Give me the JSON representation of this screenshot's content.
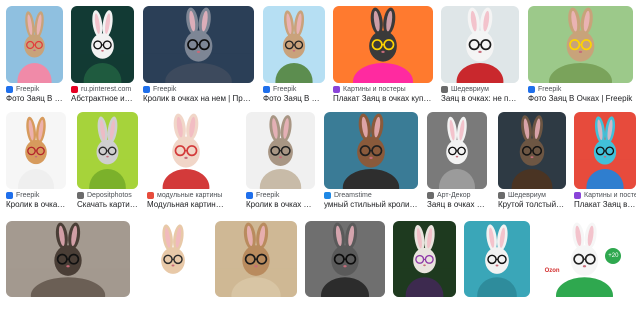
{
  "results": [
    {
      "source": "Freepik",
      "title": "Фото Заяц В Очка…",
      "favicon": "#1f6feb",
      "thumb_icon": "rabbit-pink-suit-image",
      "bg": "#8fc0e0",
      "fur": "#c8a37a",
      "glasses": "#e23b3b",
      "shirt": "#f08aa8"
    },
    {
      "source": "ru.pinterest.com",
      "title": "Абстрактное иску…",
      "favicon": "#e60023",
      "thumb_icon": "rabbit-sunglasses-image",
      "bg": "#123a34",
      "fur": "#f2f2f2",
      "glasses": "#111111",
      "shirt": "#1f5b3f"
    },
    {
      "source": "Freepik",
      "title": "Кролик в очках на нем | Премиум …",
      "favicon": "#1f6feb",
      "thumb_icon": "grey-rabbit-glasses-image",
      "bg": "#2b3f57",
      "fur": "#7d8695",
      "glasses": "#0d0d0d",
      "shirt": "#3d4a5d"
    },
    {
      "source": "Freepik",
      "title": "Фото Заяц В Очка…",
      "favicon": "#1f6feb",
      "thumb_icon": "rabbit-green-jacket-image",
      "bg": "#b6dff3",
      "fur": "#c9a27b",
      "glasses": "#222222",
      "shirt": "#5c8d4f"
    },
    {
      "source": "Картины и постеры",
      "title": "Плакат Заяц в очках купить на…",
      "favicon": "#8a44d9",
      "thumb_icon": "pop-art-rabbit-image",
      "bg": "#ff7a2f",
      "fur": "#3a3a3a",
      "glasses": "#ffd400",
      "shirt": "#ff2aa0"
    },
    {
      "source": "Шедевриум",
      "title": "Заяц в очках: не прост…",
      "favicon": "#6b6b6b",
      "thumb_icon": "rabbit-red-sweater-image",
      "bg": "#dfe6e8",
      "fur": "#f4f4f4",
      "glasses": "#1a1a1a",
      "shirt": "#c9282d"
    },
    {
      "source": "Freepik",
      "title": "Фото Заяц В Очках | Freepik",
      "favicon": "#1f6feb",
      "thumb_icon": "rabbit-landscape-image",
      "bg": "#9cc98a",
      "fur": "#c8a37a",
      "glasses": "#ffd400",
      "shirt": "#7aa35b"
    },
    {
      "source": "Freepik",
      "title": "Кролик в очках и оч…",
      "favicon": "#1f6feb",
      "thumb_icon": "fluffy-rabbit-image",
      "bg": "#f6f6f6",
      "fur": "#d79b5d",
      "glasses": "#b3242b",
      "shirt": "#efefef"
    },
    {
      "source": "Depositphotos",
      "title": "Скачать картинки …",
      "favicon": "#6b6b6b",
      "thumb_icon": "sketch-rabbit-image",
      "bg": "#a6d33b",
      "fur": "#cfcfcf",
      "glasses": "#2a2a2a",
      "shirt": "#7bb12b"
    },
    {
      "source": "модульные картины",
      "title": "Модульная картина Заяц в …",
      "favicon": "#e74c3c",
      "thumb_icon": "cute-bunny-image",
      "bg": "#ffffff",
      "fur": "#f1d6c8",
      "glasses": "#d33a3a",
      "shirt": "#d33a3a"
    },
    {
      "source": "Freepik",
      "title": "Кролик в очках и па…",
      "favicon": "#1f6feb",
      "thumb_icon": "rabbit-jacket-image",
      "bg": "#f0f0f0",
      "fur": "#a89684",
      "glasses": "#1f1f1f",
      "shirt": "#c8bba8"
    },
    {
      "source": "Dreamstime",
      "title": "умный стильный кролик в очк…",
      "favicon": "#1e88e5",
      "thumb_icon": "painted-rabbit-image",
      "bg": "#3a7c96",
      "fur": "#8a5a3b",
      "glasses": "#1f1f1f",
      "shirt": "#2e2e2e"
    },
    {
      "source": "Арт-Декор",
      "title": "Заяц в очках 40*50",
      "favicon": "#6b6b6b",
      "thumb_icon": "bw-rabbit-image",
      "bg": "#7a7a7a",
      "fur": "#f2f2f2",
      "glasses": "#0d0d0d",
      "shirt": "#9b9b9b"
    },
    {
      "source": "Шедевриум",
      "title": "Крутой толстый зая…",
      "favicon": "#6b6b6b",
      "thumb_icon": "rabbit-car-image",
      "bg": "#2e3a44",
      "fur": "#6d5643",
      "glasses": "#111111",
      "shirt": "#4a3423"
    },
    {
      "source": "Картины и постеры",
      "title": "Плакат Заяц в…",
      "favicon": "#8a44d9",
      "thumb_icon": "neon-rabbit-image",
      "bg": "#e74b3c",
      "fur": "#41c1d9",
      "glasses": "#111111",
      "shirt": "#2f7ecf"
    },
    {
      "source": "",
      "title": "",
      "favicon": "",
      "thumb_icon": "real-rabbits-sunglasses-image",
      "bg": "#a49a90",
      "fur": "#4a3e36",
      "glasses": "#111111",
      "shirt": "#6b5f55"
    },
    {
      "source": "",
      "title": "",
      "favicon": "",
      "thumb_icon": "watercolor-bunny-image",
      "bg": "#ffffff",
      "fur": "#e8c9a8",
      "glasses": "#2a2a2a",
      "shirt": "#ffffff"
    },
    {
      "source": "",
      "title": "",
      "favicon": "",
      "thumb_icon": "real-rabbit-glasses-image",
      "bg": "#cfb895",
      "fur": "#b98b5e",
      "glasses": "#1a1a1a",
      "shirt": "#d8c5a4"
    },
    {
      "source": "",
      "title": "",
      "favicon": "",
      "thumb_icon": "rabbit-motorcycle-image",
      "bg": "#6f6f6f",
      "fur": "#5a5a5a",
      "glasses": "#0d0d0d",
      "shirt": "#2c2c2c"
    },
    {
      "source": "",
      "title": "",
      "favicon": "",
      "thumb_icon": "purple-glasses-rabbit-image",
      "bg": "#1e3a1f",
      "fur": "#e9e4de",
      "glasses": "#8f3aa8",
      "shirt": "#3d2a4f"
    },
    {
      "source": "",
      "title": "",
      "favicon": "",
      "thumb_icon": "teal-rabbit-image",
      "bg": "#3aa6b8",
      "fur": "#f2f2f2",
      "glasses": "#111111",
      "shirt": "#2e8c9c"
    },
    {
      "source": "",
      "title": "",
      "favicon": "",
      "thumb_icon": "toy-rabbit-sale-image",
      "bg": "#ffffff",
      "fur": "#f6f6f6",
      "glasses": "#222222",
      "shirt": "#2fa84f",
      "sale_badge": "+20",
      "sale_note": "Ozon"
    }
  ]
}
